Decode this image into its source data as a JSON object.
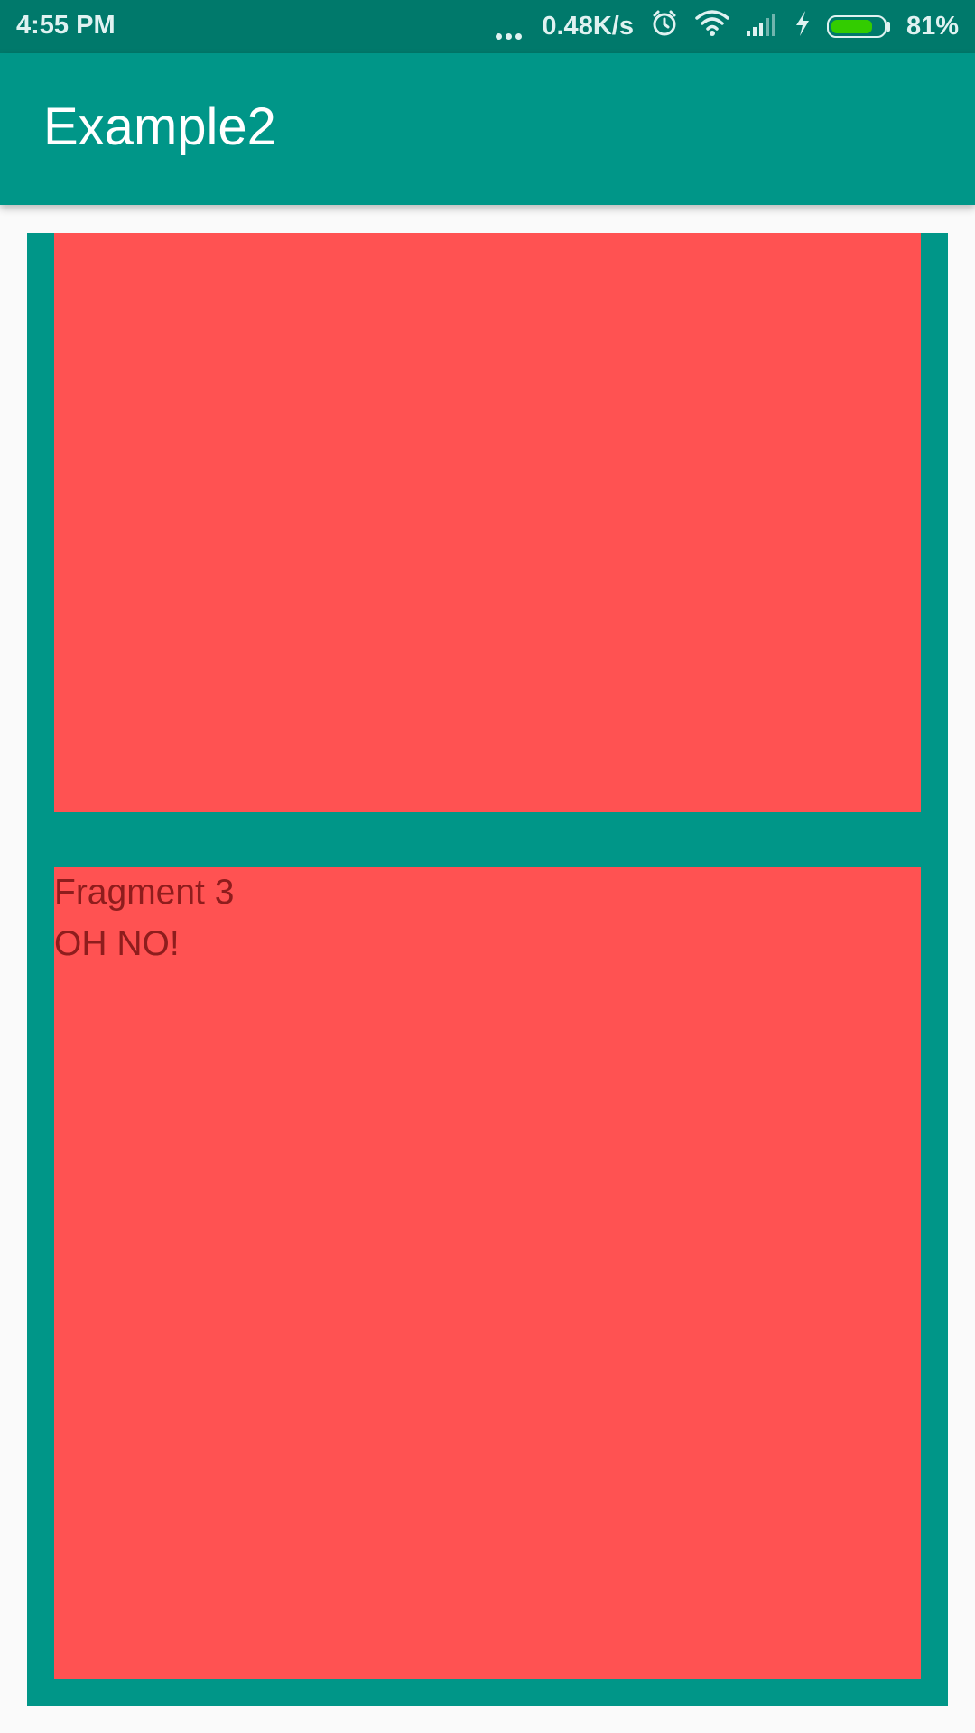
{
  "status_bar": {
    "time": "4:55 PM",
    "network_speed": "0.48K/s",
    "battery_percent": "81%",
    "battery_level": 0.81,
    "icons": [
      "more-dots-icon",
      "alarm-icon",
      "wifi-icon",
      "signal-icon",
      "charging-bolt-icon",
      "battery-icon"
    ]
  },
  "app_bar": {
    "title": "Example2",
    "color": "#009688"
  },
  "fragments": [
    {
      "label": "",
      "message": ""
    },
    {
      "label": "Fragment 3",
      "message": "OH NO!"
    }
  ],
  "colors": {
    "status_bar": "#00796B",
    "primary": "#009688",
    "fragment_background": "#FF5252",
    "fragment_text": "#8E1D1D"
  }
}
